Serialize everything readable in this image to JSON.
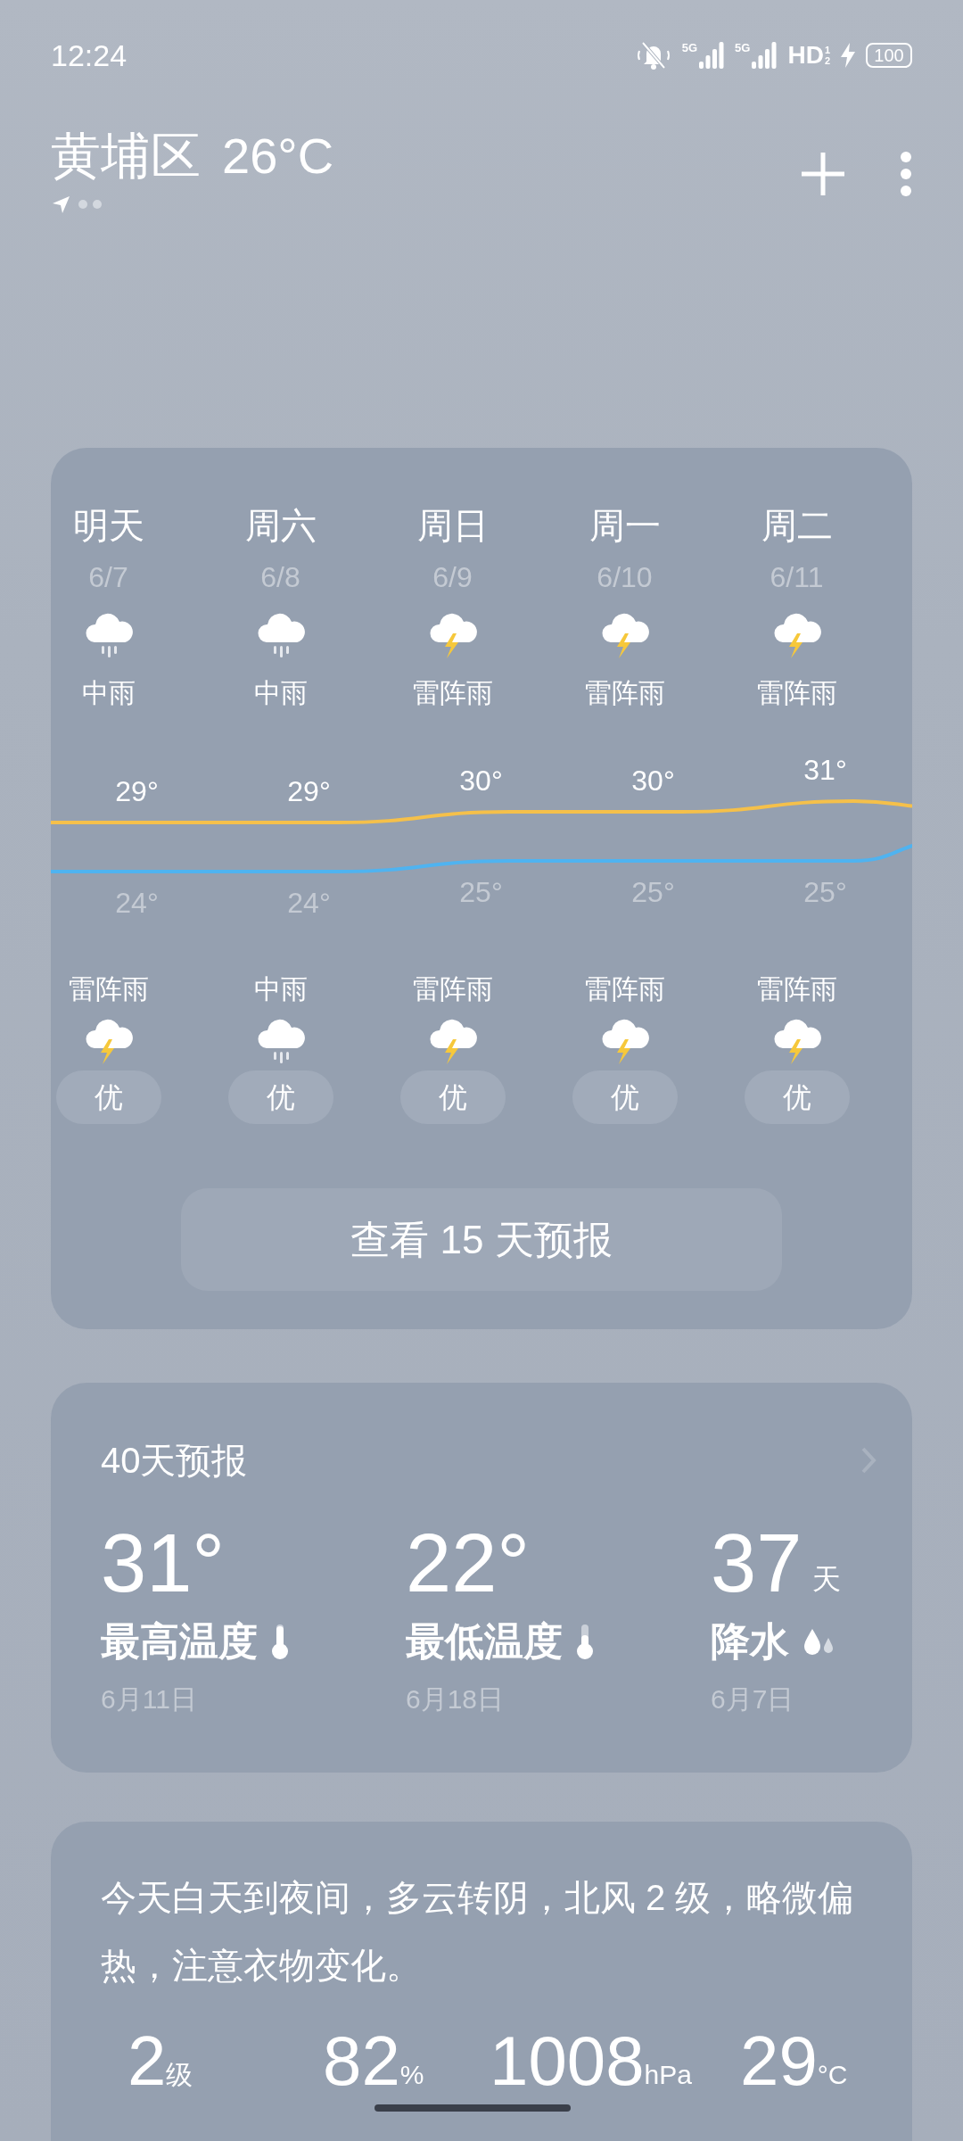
{
  "status_bar": {
    "time": "12:24",
    "signals": [
      {
        "label": "5G"
      },
      {
        "label": "5G"
      }
    ],
    "hd": "HD",
    "hd_sub": [
      "1",
      "2"
    ],
    "charging": true,
    "battery": "100"
  },
  "header": {
    "location": "黄埔区",
    "temperature": "26°C"
  },
  "forecast": {
    "days": [
      {
        "day": "明天",
        "date": "6/7",
        "day_icon": {
          "kind": "rain"
        },
        "day_condition": "中雨",
        "high": "29°",
        "low": "24°",
        "night_condition": "雷阵雨",
        "night_icon": {
          "kind": "thunder"
        },
        "aqi": "优"
      },
      {
        "day": "周六",
        "date": "6/8",
        "day_icon": {
          "kind": "rain"
        },
        "day_condition": "中雨",
        "high": "29°",
        "low": "24°",
        "night_condition": "中雨",
        "night_icon": {
          "kind": "rain"
        },
        "aqi": "优"
      },
      {
        "day": "周日",
        "date": "6/9",
        "day_icon": {
          "kind": "thunder"
        },
        "day_condition": "雷阵雨",
        "high": "30°",
        "low": "25°",
        "night_condition": "雷阵雨",
        "night_icon": {
          "kind": "thunder"
        },
        "aqi": "优"
      },
      {
        "day": "周一",
        "date": "6/10",
        "day_icon": {
          "kind": "thunder"
        },
        "day_condition": "雷阵雨",
        "high": "30°",
        "low": "25°",
        "night_condition": "雷阵雨",
        "night_icon": {
          "kind": "thunder"
        },
        "aqi": "优"
      },
      {
        "day": "周二",
        "date": "6/11",
        "day_icon": {
          "kind": "thunder"
        },
        "day_condition": "雷阵雨",
        "high": "31°",
        "low": "25°",
        "night_condition": "雷阵雨",
        "night_icon": {
          "kind": "thunder"
        },
        "aqi": "优"
      }
    ],
    "button": "查看 15 天预报"
  },
  "forecast_40": {
    "title": "40天预报",
    "stats": [
      {
        "value": "31°",
        "label": "最高温度",
        "kind": "thermometer_high",
        "date": "6月11日"
      },
      {
        "value": "22°",
        "label": "最低温度",
        "kind": "thermometer_low",
        "date": "6月18日"
      },
      {
        "value": "37",
        "unit": "天",
        "label": "降水",
        "kind": "drops",
        "date": "6月7日"
      }
    ]
  },
  "summary": {
    "text": "今天白天到夜间，多云转阴，北风 2 级，略微偏热，注意衣物变化。",
    "stats": [
      {
        "value": "2",
        "unit": "级"
      },
      {
        "value": "82",
        "unit": "%"
      },
      {
        "value": "1008",
        "unit": "hPa"
      },
      {
        "value": "29",
        "unit": "°C"
      }
    ]
  }
}
